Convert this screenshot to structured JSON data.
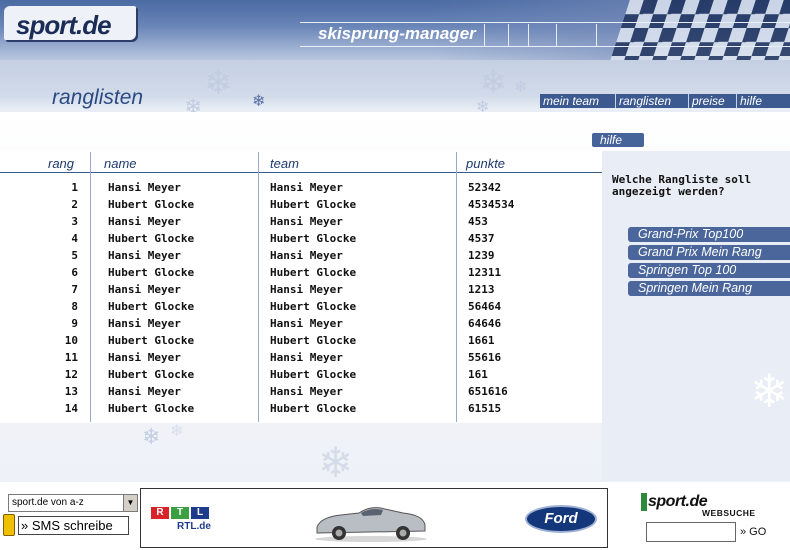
{
  "header": {
    "logo": "sport.de",
    "app_title": "skisprung-manager"
  },
  "page": {
    "title": "ranglisten",
    "help_tab": "hilfe"
  },
  "top_nav": {
    "items": [
      "mein team",
      "ranglisten",
      "preise",
      "hilfe"
    ]
  },
  "table": {
    "columns": [
      "rang",
      "name",
      "team",
      "punkte"
    ],
    "rows": [
      {
        "rank": "1",
        "name": "Hansi Meyer",
        "team": "Hansi Meyer",
        "points": "52342"
      },
      {
        "rank": "2",
        "name": "Hubert Glocke",
        "team": "Hubert Glocke",
        "points": "4534534"
      },
      {
        "rank": "3",
        "name": "Hansi Meyer",
        "team": "Hansi Meyer",
        "points": "453"
      },
      {
        "rank": "4",
        "name": "Hubert Glocke",
        "team": "Hubert Glocke",
        "points": "4537"
      },
      {
        "rank": "5",
        "name": "Hansi Meyer",
        "team": "Hansi Meyer",
        "points": "1239"
      },
      {
        "rank": "6",
        "name": "Hubert Glocke",
        "team": "Hubert Glocke",
        "points": "12311"
      },
      {
        "rank": "7",
        "name": "Hansi Meyer",
        "team": "Hansi Meyer",
        "points": "1213"
      },
      {
        "rank": "8",
        "name": "Hubert Glocke",
        "team": "Hubert Glocke",
        "points": "56464"
      },
      {
        "rank": "9",
        "name": "Hansi Meyer",
        "team": "Hansi Meyer",
        "points": "64646"
      },
      {
        "rank": "10",
        "name": "Hubert Glocke",
        "team": "Hubert Glocke",
        "points": "1661"
      },
      {
        "rank": "11",
        "name": "Hansi Meyer",
        "team": "Hansi Meyer",
        "points": "55616"
      },
      {
        "rank": "12",
        "name": "Hubert Glocke",
        "team": "Hubert Glocke",
        "points": "161"
      },
      {
        "rank": "13",
        "name": "Hansi Meyer",
        "team": "Hansi Meyer",
        "points": "651616"
      },
      {
        "rank": "14",
        "name": "Hubert Glocke",
        "team": "Hubert Glocke",
        "points": "61515"
      }
    ]
  },
  "sidebar": {
    "question": "Welche Rangliste soll angezeigt werden?",
    "buttons": [
      "Grand-Prix Top100",
      "Grand Prix Mein Rang",
      "Springen Top 100",
      "Springen Mein Rang"
    ]
  },
  "footer": {
    "az_select_value": "sport.de von a-z",
    "sms_button": "» SMS schreibe",
    "banner": {
      "rtl_letters": [
        "R",
        "T",
        "L"
      ],
      "rtl_site": "RTL.de",
      "ford": "Ford"
    },
    "websuche": {
      "logo": "sport.de",
      "label": "WEBSUCHE",
      "go": "» GO"
    }
  },
  "colors": {
    "nav_blue": "#3c5a90",
    "sidebar_button": "#4a669b",
    "heading_blue": "#2b4a82",
    "rtl_red": "#d8232a",
    "rtl_blue": "#1f3c8c",
    "rtl_green": "#3aa040"
  }
}
